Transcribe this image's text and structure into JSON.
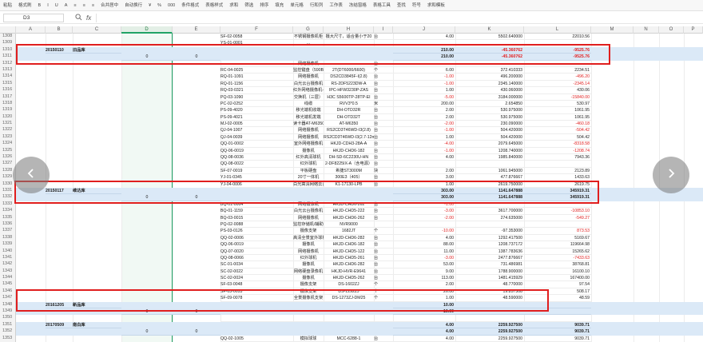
{
  "toolbar": {
    "items": [
      "粘贴",
      "格式刷",
      "B",
      "I",
      "U",
      "A",
      "≡",
      "≡",
      "≡",
      "合并居中",
      "自动换行",
      "¥",
      "%",
      "000",
      "条件格式",
      "表格样式",
      "求和",
      "筛选",
      "排序",
      "填充",
      "单元格",
      "行和列",
      "工作表",
      "冻结窗格",
      "表格工具",
      "查找",
      "符号",
      "求和模板"
    ]
  },
  "formula_bar": {
    "cell_ref": "D3",
    "zoom_icon": "zoom-icon",
    "fx_label": "fx",
    "content": ""
  },
  "columns": [
    "A",
    "B",
    "C",
    "D",
    "E",
    "F",
    "G",
    "H",
    "I",
    "J",
    "K",
    "L",
    "M",
    "N",
    "O",
    "P"
  ],
  "selected_column": "D",
  "rows": [
    {
      "n": "1308",
      "f": "SF-02-0058",
      "g": "不锈钢摄像机柜",
      "h": "摄大尺寸，适合量小于20",
      "i": "台",
      "j": "4.00",
      "k": "5502.640000",
      "l": "22010.56"
    },
    {
      "n": "1309",
      "f": "YS-01-0001",
      "g": "...",
      "h": "",
      "i": "",
      "j": "",
      "k": "",
      "l": ""
    },
    {
      "n": "1310",
      "sum": true,
      "b": "20150110",
      "c": "旧品库",
      "j": "210.00",
      "k": "-45.360762",
      "l": "-9525.76",
      "red": true
    },
    {
      "n": "1311",
      "sum": true,
      "d": "0",
      "e": "0",
      "j": "210.00",
      "k": "-45.360762",
      "l": "-9525.76",
      "red": true
    },
    {
      "n": "1312",
      "f": "",
      "g": "网络摄像机",
      "h": "",
      "i": "台",
      "j": "",
      "k": "",
      "l": ""
    },
    {
      "n": "1313",
      "f": "RC-04-0025",
      "g": "监控键盘（590B系）",
      "h": "2T(DT6000/6600)",
      "i": "个",
      "j": "6.00",
      "k": "372.410333",
      "l": "2234.51"
    },
    {
      "n": "1314",
      "f": "RQ-01-1091",
      "g": "网络摄像机",
      "h": "DS2CD3845F-I(2.8)",
      "i": "台",
      "j": "-1.00",
      "k": "496.200000",
      "l": "-496.20",
      "red_jl": true
    },
    {
      "n": "1315",
      "f": "RQ-01-1156",
      "g": "白光云台摄像机",
      "h": "RS-2DF5223DW-A",
      "i": "台",
      "j": "-1.00",
      "k": "2345.140000",
      "l": "-2345.14",
      "red_jl": true
    },
    {
      "n": "1316",
      "f": "RQ-03-0321",
      "g": "红外网络摄像机-大华标准",
      "h": "IPC-HFW3230P-ZAS",
      "i": "台",
      "j": "1.00",
      "k": "430.060000",
      "l": "430.06"
    },
    {
      "n": "1317",
      "f": "PQ-03-1090",
      "g": "交换机（三层）",
      "h": "H3C S5600TP-28TP-EI",
      "i": "台",
      "j": "-5.00",
      "k": "3184.000000",
      "l": "-15840.00",
      "red_jl": true
    },
    {
      "n": "1318",
      "f": "PC-02-0252",
      "g": "线缆",
      "h": "RVV3*0.5",
      "i": "米",
      "j": "200.00",
      "k": "2.654850",
      "l": "530.97"
    },
    {
      "n": "1319",
      "f": "PS-09-4020",
      "g": "移光端机收端",
      "h": "DH-OTD32R",
      "i": "台",
      "j": "2.00",
      "k": "530.975000",
      "l": "1061.95"
    },
    {
      "n": "1320",
      "f": "PS-09-4021",
      "g": "移光端机发端",
      "h": "DH-OTD32T",
      "i": "台",
      "j": "2.00",
      "k": "530.975000",
      "l": "1061.95"
    },
    {
      "n": "1321",
      "f": "MJ-02-0005",
      "g": "读卡器AT-M6350",
      "h": "AT-M6350",
      "i": "台",
      "j": "-2.00",
      "k": "230.090000",
      "l": "-460.18",
      "red_jl": true
    },
    {
      "n": "1322",
      "f": "QJ-04-1007",
      "g": "网络摄像机",
      "h": "RS2CD3T46WD-I3(2.8)",
      "i": "台",
      "j": "-1.00",
      "k": "504.420000",
      "l": "-504.42",
      "red_jl": true
    },
    {
      "n": "1323",
      "f": "QJ-04-0039",
      "g": "网络摄像机",
      "h": "RS2CD3T46WD-I3(2.7-12mm)",
      "i": "台",
      "j": "1.00",
      "k": "504.420000",
      "l": "504.42"
    },
    {
      "n": "1324",
      "f": "QQ-01-0002",
      "g": "室外网络摄像机",
      "h": "HKJD-CDH3-28A-A",
      "i": "台",
      "j": "-4.00",
      "k": "2079.645000",
      "l": "-8318.58",
      "red_jl": true
    },
    {
      "n": "1325",
      "f": "QQ-06-0019",
      "g": "摄像机",
      "h": "HKJD-CHD6-182",
      "i": "台",
      "j": "-1.00",
      "k": "1208.740000",
      "l": "-1208.74",
      "red_jl": true
    },
    {
      "n": "1326",
      "f": "QQ-08-0036",
      "g": "红外高清球机",
      "h": "DH-SD-6C2230U-HN",
      "i": "台",
      "j": "4.00",
      "k": "1985.840000",
      "l": "7943.36"
    },
    {
      "n": "1327",
      "f": "QQ-08-0022",
      "g": "红外球机",
      "h": "2-DF8225IX-A（含电源）",
      "i": "台",
      "j": "",
      "k": "",
      "l": ""
    },
    {
      "n": "1328",
      "f": "SF-07-0019",
      "g": "平板硬盘",
      "h": "希捷ST3000M",
      "i": "块",
      "j": "2.00",
      "k": "1061.945000",
      "l": "2123.89"
    },
    {
      "n": "1329",
      "f": "YJ-01-0345",
      "g": "20寸一体机",
      "h": "300E3（405）",
      "i": "台",
      "j": "3.00",
      "k": "477.876667",
      "l": "1433.63"
    },
    {
      "n": "1330",
      "f": "YJ-04-0006",
      "g": "白光高清网络云台摄像机",
      "h": "K1-17130-LPB",
      "i": "台",
      "j": "1.00",
      "k": "2619.750000",
      "l": "2619.75"
    },
    {
      "n": "1331",
      "sum": true,
      "b": "20150117",
      "c": "维达库",
      "j": "303.00",
      "k": "1141.647888",
      "l": "345919.31"
    },
    {
      "n": "1332",
      "sum": true,
      "d": "0",
      "e": "0",
      "j": "303.00",
      "k": "1141.647888",
      "l": "345919.31"
    },
    {
      "n": "1333",
      "f": "BQ-01-0004",
      "g": "网络摄像机",
      "h": "HKJD-CHD6-262",
      "i": "台",
      "j": "-1.00",
      "k": "",
      "l": "",
      "red_jl": true
    },
    {
      "n": "1334",
      "f": "BQ-01-1159",
      "g": "白光云台摄像机",
      "h": "HKJD-CHD5-222",
      "i": "台",
      "j": "-3.00",
      "k": "3617.700000",
      "l": "-10853.10",
      "red_jl": true
    },
    {
      "n": "1335",
      "f": "BQ-03-0015",
      "g": "网络摄像机",
      "h": "HKJD-CHD6-262",
      "i": "台",
      "j": "-2.00",
      "k": "274.635000",
      "l": "-549.27",
      "red_jl": true
    },
    {
      "n": "1336",
      "f": "PQ-02-0088",
      "g": "监控存储机/辅助系统",
      "h": "NVR9000",
      "i": "",
      "j": "",
      "k": "",
      "l": ""
    },
    {
      "n": "1337",
      "f": "PS-03-0126",
      "g": "摄像支架",
      "h": "1682JT",
      "i": "个",
      "j": "-10.00",
      "k": "-97.353000",
      "l": "873.53",
      "red_jl": true
    },
    {
      "n": "1338",
      "f": "QQ-02-0006",
      "g": "高清全景室外球机",
      "h": "HKJD-CHD6-282",
      "i": "台",
      "j": "4.00",
      "k": "1292.417500",
      "l": "5169.67"
    },
    {
      "n": "1339",
      "f": "QQ-06-0019",
      "g": "摄像机",
      "h": "HKJD-CHD6-182",
      "i": "台",
      "j": "88.00",
      "k": "1208.737172",
      "l": "119664.98"
    },
    {
      "n": "1340",
      "f": "QQ-07-0020",
      "g": "网络摄像机",
      "h": "HKJD-CHD5-122",
      "i": "台",
      "j": "11.00",
      "k": "1387.783636",
      "l": "15265.62"
    },
    {
      "n": "1341",
      "f": "QQ-08-0066",
      "g": "红外球机",
      "h": "HKJD-CHD5-261",
      "i": "台",
      "j": "-3.00",
      "k": "2477.876667",
      "l": "-7433.63",
      "red_jl": true
    },
    {
      "n": "1342",
      "f": "SC-01-0034",
      "g": "摄像机",
      "h": "HKJD-CHD6-282",
      "i": "台",
      "j": "53.00",
      "k": "731.486981",
      "l": "38768.81"
    },
    {
      "n": "1343",
      "f": "SC-02-0022",
      "g": "网络硬盘录像机",
      "h": "HKJD-HVR-E9641",
      "i": "台",
      "j": "9.00",
      "k": "1788.900000",
      "l": "16100.10"
    },
    {
      "n": "1344",
      "f": "SC-02-0024",
      "g": "摄像机",
      "h": "HKJD-CHD5-262",
      "i": "台",
      "j": "113.00",
      "k": "1481.415929",
      "l": "167400.00"
    },
    {
      "n": "1345",
      "f": "SF-03-0048",
      "g": "摄像支架",
      "h": "DS-1602ZJ",
      "i": "个",
      "j": "2.00",
      "k": "48.770000",
      "l": "97.54"
    },
    {
      "n": "1346",
      "f": "SF-03-0053",
      "g": "摄像支架",
      "h": "DS-1292ZJ",
      "i": "个",
      "j": "26.00",
      "k": "19.857308",
      "l": "508.17"
    },
    {
      "n": "1347",
      "f": "SF-09-0078",
      "g": "全景摄像机支架",
      "h": "DS-1273ZJ-DM25",
      "i": "个",
      "j": "1.00",
      "k": "48.590000",
      "l": "48.59"
    },
    {
      "n": "1348",
      "sum": true,
      "b": "20161205",
      "c": "新品库",
      "j": "10.00",
      "k": "",
      "l": ""
    },
    {
      "n": "1349",
      "sum": true,
      "d": "0",
      "e": "0",
      "j": "10.00",
      "k": "",
      "l": ""
    },
    {
      "n": "1350",
      "f": "",
      "g": "",
      "h": "",
      "i": "",
      "j": "",
      "k": "",
      "l": ""
    },
    {
      "n": "1351",
      "sum": true,
      "b": "20170509",
      "c": "南白库",
      "j": "4.00",
      "k": "2259.927500",
      "l": "9039.71"
    },
    {
      "n": "1352",
      "sum": true,
      "d": "0",
      "e": "0",
      "j": "4.00",
      "k": "2259.927500",
      "l": "9039.71"
    },
    {
      "n": "1353",
      "f": "QQ-02-1005",
      "g": "模拟球球",
      "h": "MCC-6288-1",
      "i": "台",
      "j": "4.00",
      "k": "2259.927500",
      "l": "9039.71"
    }
  ],
  "colors": {
    "accent": "#21a366",
    "summary_fill": "#dbe9f7",
    "negative": "#e02020",
    "highlight_box": "#e01e1e"
  },
  "nav": {
    "prev_icon": "chevron-left-icon",
    "next_icon": "chevron-right-icon"
  }
}
